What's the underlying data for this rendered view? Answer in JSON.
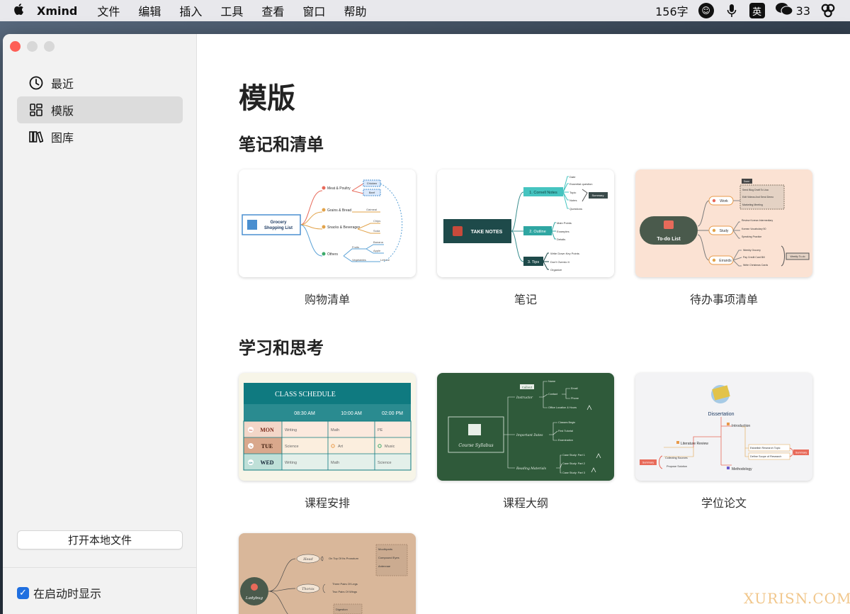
{
  "menubar": {
    "app_name": "Xmind",
    "items": [
      "文件",
      "编辑",
      "插入",
      "工具",
      "查看",
      "窗口",
      "帮助"
    ],
    "word_count": "156字",
    "input_method": "英",
    "wechat_count": "33"
  },
  "sidebar": {
    "nav": [
      {
        "label": "最近",
        "icon": "clock-icon"
      },
      {
        "label": "模版",
        "icon": "grid-icon",
        "active": true
      },
      {
        "label": "图库",
        "icon": "library-icon"
      }
    ],
    "open_local_label": "打开本地文件",
    "show_on_startup_label": "在启动时显示",
    "show_on_startup_checked": true
  },
  "main": {
    "title": "模版",
    "sections": [
      {
        "title": "笔记和清单",
        "cards": [
          {
            "label": "购物清单"
          },
          {
            "label": "笔记"
          },
          {
            "label": "待办事项清单"
          }
        ]
      },
      {
        "title": "学习和思考",
        "cards": [
          {
            "label": "课程安排"
          },
          {
            "label": "课程大纲"
          },
          {
            "label": "学位论文"
          }
        ]
      }
    ]
  },
  "thumbs": {
    "shopping": {
      "center": "Grocery",
      "center2": "Shopping List",
      "b1": "Meat & Poultry",
      "b2": "Grains & Bread",
      "b3": "Snacks & Beverages",
      "b4": "Others",
      "l1": "Chicken",
      "l2": "Beef",
      "l3": "Oatmeal",
      "l4": "Chips",
      "l5": "Soda",
      "l6": "Banana",
      "l7": "Apple",
      "l8": "Fruits",
      "l9": "Vegetables",
      "l10": "Lettuce"
    },
    "notes": {
      "center": "TAKE NOTES",
      "b1": "1. Cornell Notes",
      "b2": "2. Outline",
      "b3": "3. Tips",
      "l1": "Date",
      "l2": "Essential question",
      "l3": "Topic",
      "l4": "Notes",
      "l5": "Questions",
      "l6": "Summary",
      "l7": "Main Points",
      "l8": "Examples",
      "l9": "Details",
      "l10": "Write Down Key Points",
      "l11": "Don't Overdo It",
      "l12": "Organize"
    },
    "todo": {
      "center": "To-do List",
      "b1": "Work",
      "b2": "Study",
      "b3": "Errands",
      "tag": "Done",
      "l1": "Send Blog Draft To Lisa",
      "l2": "Edit Videos And Send Demo",
      "l3": "Marketing Meeting",
      "l4": "Review Korean Intermediary",
      "l5": "Korean Vocabulary 50",
      "l6": "Speaking Practice",
      "l7": "Weekly Grocery",
      "l8": "Pay Credit Card Bill",
      "l9": "Write Christmas Cards",
      "l10": "Weekly To-do"
    },
    "schedule": {
      "title": "CLASS SCHEDULE",
      "times": [
        "08:30 AM",
        "10:00 AM",
        "02:00 PM"
      ],
      "rows": [
        {
          "day": "MON",
          "abbr": "Mo",
          "cells": [
            "Writing",
            "Math",
            "PE"
          ]
        },
        {
          "day": "TUE",
          "abbr": "Tu",
          "cells": [
            "Science",
            "Art",
            "Music"
          ]
        },
        {
          "day": "WED",
          "abbr": "We",
          "cells": [
            "Writing",
            "Math",
            "Science"
          ]
        }
      ]
    },
    "syllabus": {
      "center": "Course Syllabus",
      "b1": "Instructor",
      "b2": "Important Dates",
      "b3": "Reading Materials",
      "tag": "Callout",
      "l1": "Name",
      "l2": "Contact",
      "l3": "Email",
      "l4": "Phone",
      "l5": "Office Location & Hours",
      "l6": "Classes Begin",
      "l7": "First Tutorial",
      "l8": "Examination",
      "l9": "Case Study: Part 1",
      "l10": "Case Study: Part 2",
      "l11": "Case Study: Part 3"
    },
    "dissertation": {
      "center": "Dissertation",
      "b1": "Introduction",
      "b2": "Literature Review",
      "b3": "Methodology",
      "l1": "Establish Research Topic",
      "l2": "Define Scope of Research",
      "l3": "Collecting Sources",
      "l4": "Propose Solution",
      "s1": "Summary",
      "s2": "Summary"
    },
    "ladybug": {
      "center": "Ladybug",
      "b1": "Head",
      "b2": "Thorax",
      "l1": "On Top Of Its Pronotum",
      "l2": "Mouthparts",
      "l3": "Compound Eyes",
      "l4": "Antennae",
      "l5": "Three Pairs Of Legs",
      "l6": "Two Pairs Of Wings",
      "l7": "Digestion"
    }
  },
  "watermark": "XURISN.COM",
  "colors": {
    "accent": "#1f6fe0",
    "close": "#fe5f57",
    "sidebar_bg": "#f2f2f2"
  }
}
